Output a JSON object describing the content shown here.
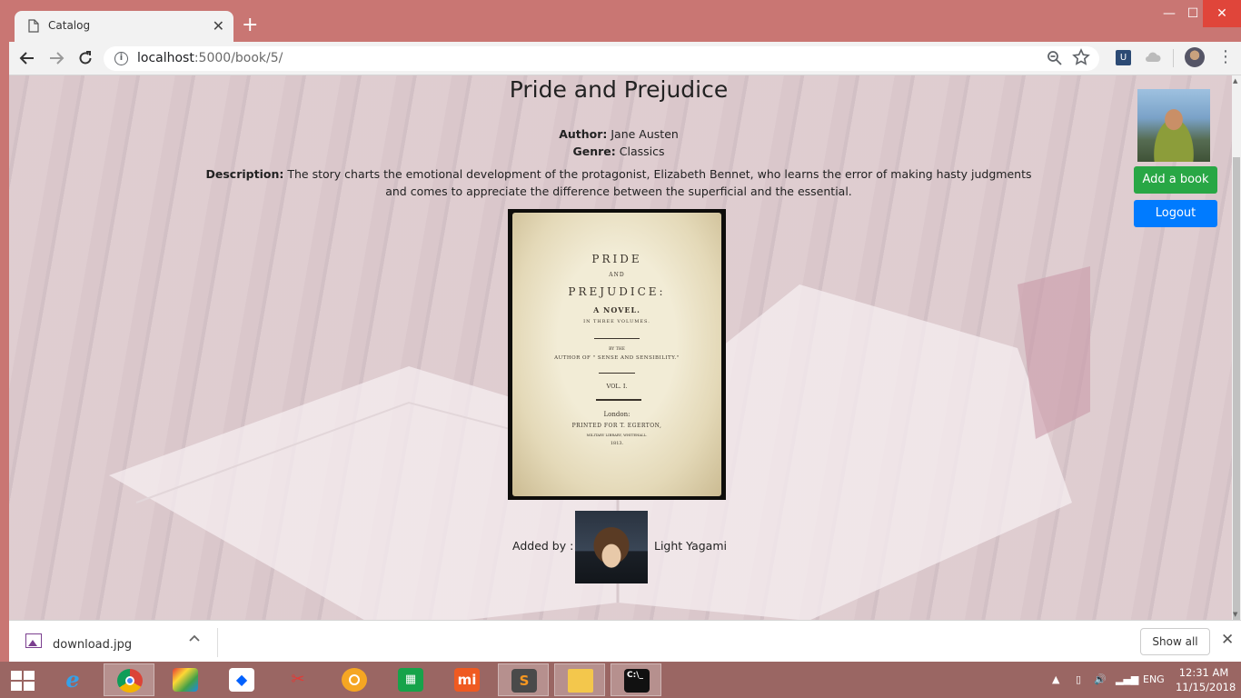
{
  "browser": {
    "tab_title": "Catalog",
    "new_tab_glyph": "+",
    "tab_close_glyph": "✕",
    "url_host": "localhost",
    "url_rest": ":5000/book/5/",
    "window_controls": {
      "minimize": "—",
      "maximize": "☐",
      "close": "✕"
    }
  },
  "page": {
    "title": "Pride and Prejudice",
    "author_label": "Author:",
    "author": "Jane Austen",
    "genre_label": "Genre:",
    "genre": "Classics",
    "description_label": "Description:",
    "description": "The story charts the emotional development of the protagonist, Elizabeth Bennet, who learns the error of making hasty judgments and comes to appreciate the difference between the superficial and the essential.",
    "added_by_label": "Added by :",
    "added_by_name": "Light Yagami",
    "buttons": {
      "add_book": "Add a book",
      "logout": "Logout"
    }
  },
  "cover": {
    "line1": "PRIDE",
    "line2": "AND",
    "line3": "PREJUDICE:",
    "line4": "A NOVEL.",
    "line5": "IN THREE VOLUMES.",
    "line6": "BY THE",
    "line7": "AUTHOR OF \" SENSE AND SENSIBILITY.\"",
    "line8": "VOL. I.",
    "line9": "London:",
    "line10": "PRINTED FOR T. EGERTON,",
    "line11": "MILITARY LIBRARY, WHITEHALL.",
    "line12": "1813."
  },
  "downloads": {
    "file_name": "download.jpg",
    "show_all": "Show all"
  },
  "taskbar": {
    "language": "ENG",
    "time": "12:31 AM",
    "date": "11/15/2018"
  },
  "colors": {
    "frame": "#c97673",
    "add_button": "#28a745",
    "logout_button": "#007bff"
  }
}
